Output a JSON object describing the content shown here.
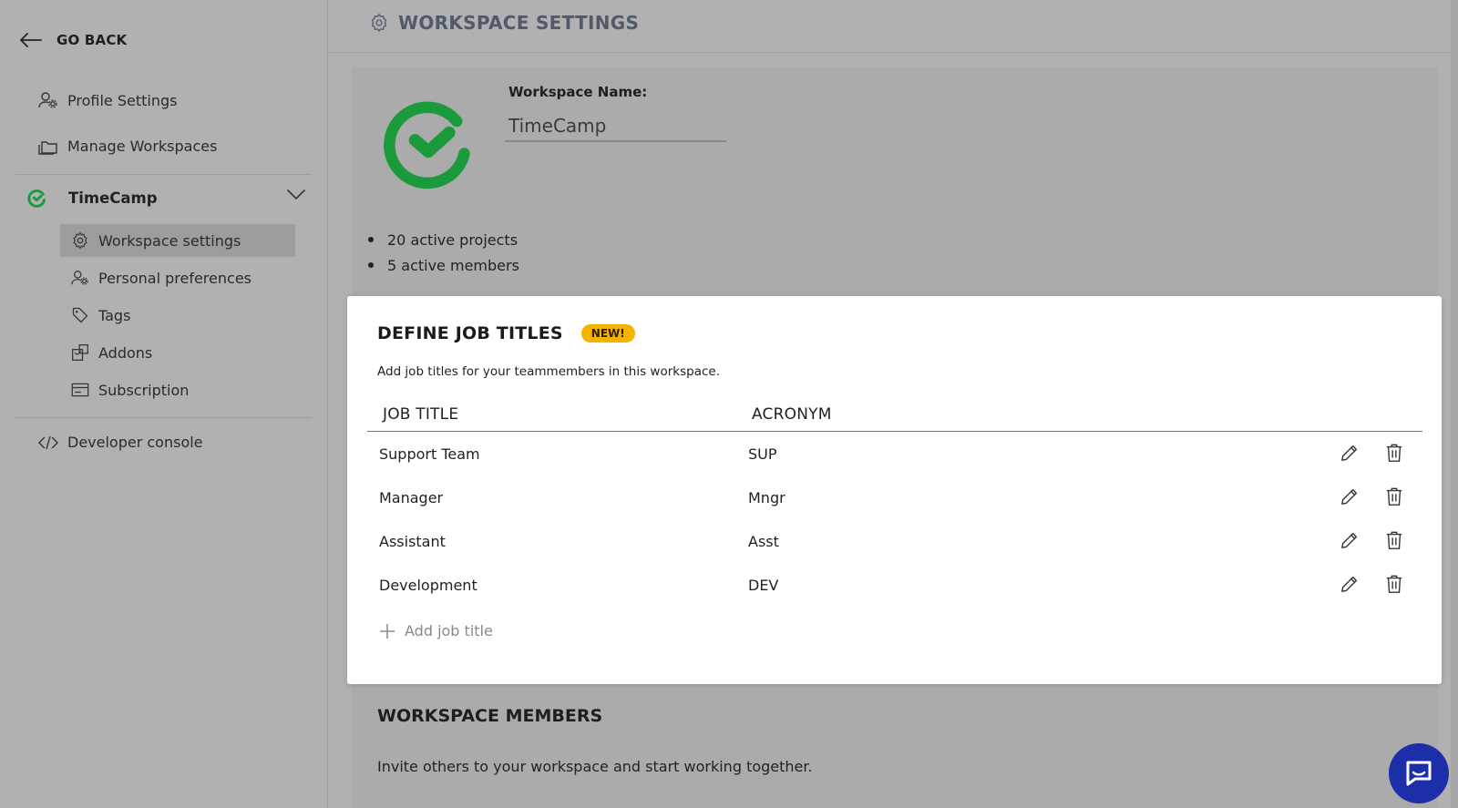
{
  "sidebar": {
    "go_back": "GO BACK",
    "items": [
      {
        "label": "Profile Settings",
        "icon": "user-gear-icon"
      },
      {
        "label": "Manage Workspaces",
        "icon": "folders-icon"
      }
    ],
    "workspace": {
      "name": "TimeCamp",
      "sub_items": [
        {
          "label": "Workspace settings",
          "icon": "gear-icon",
          "active": true
        },
        {
          "label": "Personal preferences",
          "icon": "user-gear-icon"
        },
        {
          "label": "Tags",
          "icon": "tag-icon"
        },
        {
          "label": "Addons",
          "icon": "addons-icon"
        },
        {
          "label": "Subscription",
          "icon": "card-icon"
        }
      ]
    },
    "developer": {
      "label": "Developer console",
      "icon": "code-icon"
    }
  },
  "header": {
    "title": "WORKSPACE SETTINGS"
  },
  "workspace_info": {
    "name_label": "Workspace Name:",
    "name_value": "TimeCamp",
    "stats": [
      "20 active projects",
      "5 active members"
    ]
  },
  "jobs": {
    "title": "DEFINE JOB TITLES",
    "badge": "NEW!",
    "description": "Add job titles for your teammembers in this workspace.",
    "col_title": "JOB TITLE",
    "col_acronym": "ACRONYM",
    "rows": [
      {
        "title": "Support Team",
        "acronym": "SUP"
      },
      {
        "title": "Manager",
        "acronym": "Mngr"
      },
      {
        "title": "Assistant",
        "acronym": "Asst"
      },
      {
        "title": "Development",
        "acronym": "DEV"
      }
    ],
    "add_label": "Add job title"
  },
  "members": {
    "title": "WORKSPACE MEMBERS",
    "description": "Invite others to your workspace and start working together."
  },
  "colors": {
    "brand_green": "#1b9a3c",
    "badge": "#f5b300",
    "chat": "#1c2fa8",
    "header_title": "#4f5b68"
  }
}
